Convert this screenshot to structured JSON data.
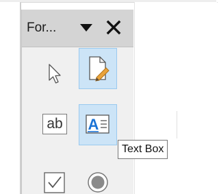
{
  "toolbar": {
    "title": "For...",
    "dropdown_icon": "triangle-down-icon",
    "close_icon": "close-icon",
    "tools": [
      {
        "name": "select-tool",
        "icon": "pointer-arrow-icon",
        "selected": false
      },
      {
        "name": "design-mode-tool",
        "icon": "document-edit-icon",
        "selected": true
      },
      {
        "name": "label-tool",
        "icon": "label-ab-icon",
        "label": "ab",
        "selected": false
      },
      {
        "name": "text-box-tool",
        "icon": "text-box-icon",
        "label": "A",
        "selected": true
      },
      {
        "name": "checkbox-tool",
        "icon": "checkbox-icon",
        "selected": false
      },
      {
        "name": "option-button-tool",
        "icon": "radio-button-icon",
        "selected": false
      }
    ]
  },
  "tooltip": {
    "text": "Text Box"
  },
  "colors": {
    "header_bg": "#d4d4d4",
    "toolbar_bg": "#f0f0f0",
    "selected_bg": "#cce4f7",
    "selected_border": "#99c9ef",
    "accent_blue": "#1a73d6",
    "pencil_orange": "#e8a33c"
  }
}
